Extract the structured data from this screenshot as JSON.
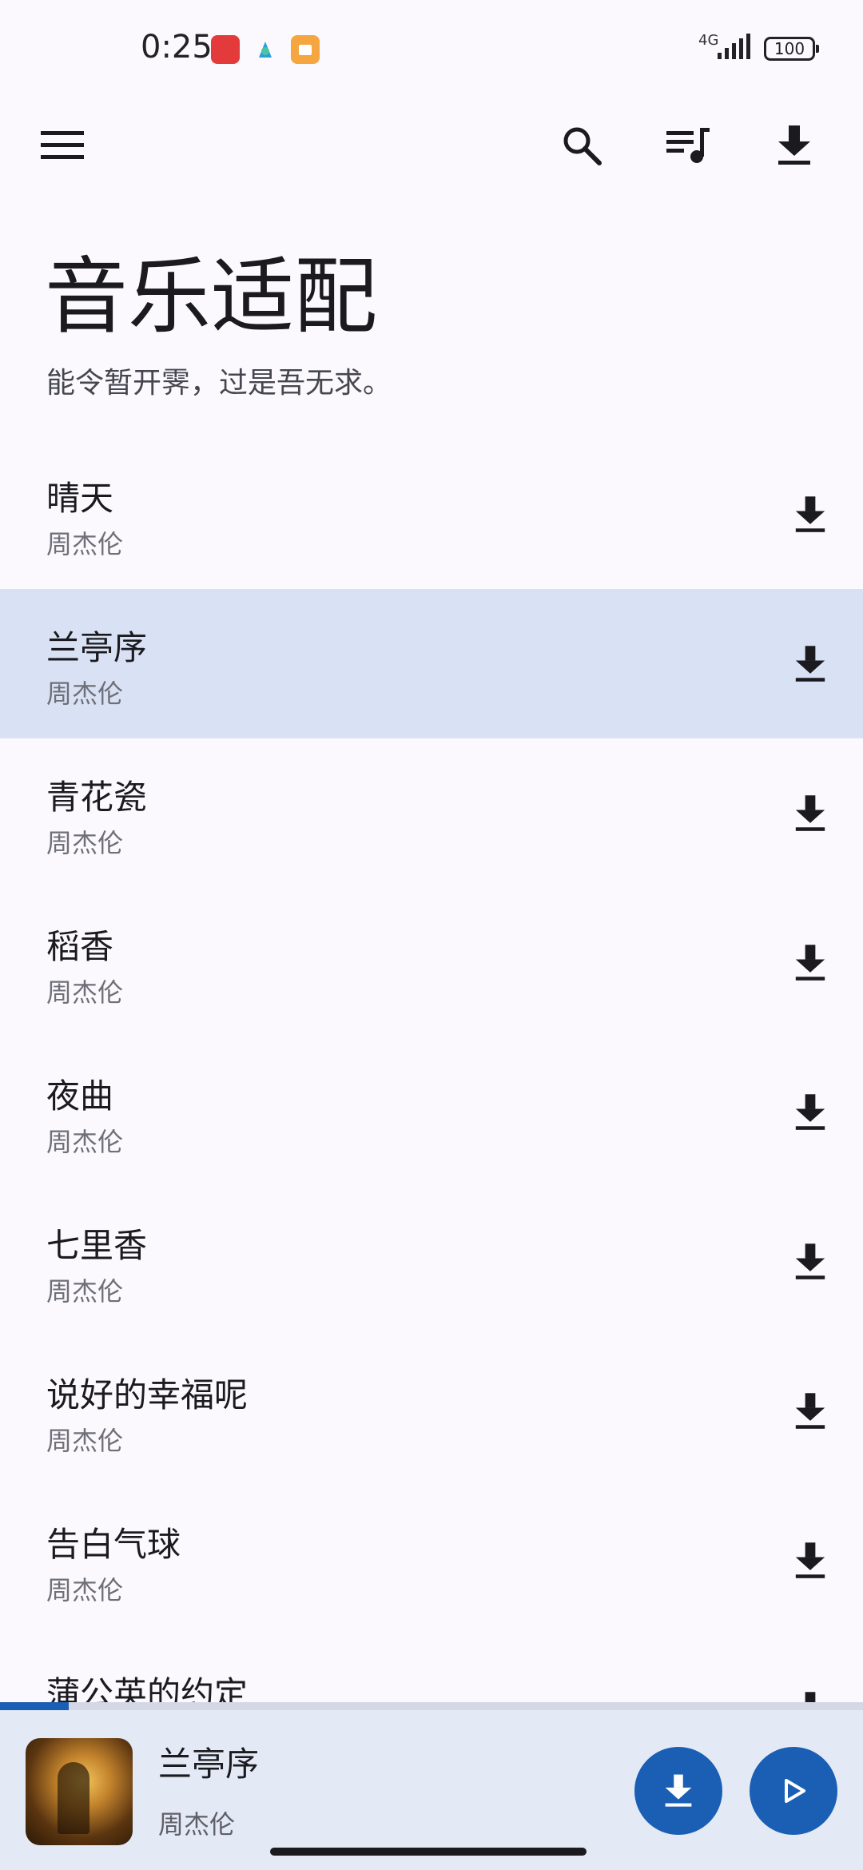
{
  "status": {
    "time": "0:25",
    "network": "4G",
    "battery": "100"
  },
  "header": {
    "title": "音乐适配",
    "subtitle": "能令暂开霁，过是吾无求。"
  },
  "songs": [
    {
      "title": "晴天",
      "artist": "周杰伦"
    },
    {
      "title": "兰亭序",
      "artist": "周杰伦"
    },
    {
      "title": "青花瓷",
      "artist": "周杰伦"
    },
    {
      "title": "稻香",
      "artist": "周杰伦"
    },
    {
      "title": "夜曲",
      "artist": "周杰伦"
    },
    {
      "title": "七里香",
      "artist": "周杰伦"
    },
    {
      "title": "说好的幸福呢",
      "artist": "周杰伦"
    },
    {
      "title": "告白气球",
      "artist": "周杰伦"
    },
    {
      "title": "蒲公英的约定",
      "artist": ""
    }
  ],
  "selected_index": 1,
  "player": {
    "title": "兰亭序",
    "artist": "周杰伦",
    "progress_fraction": 0.08
  },
  "colors": {
    "accent": "#1a5fb4",
    "selected_row": "#d9e2f4",
    "player_bg": "#e4e9f6",
    "background": "#fbf9fe"
  },
  "icons": {
    "menu": "hamburger-menu-icon",
    "search": "search-icon",
    "queue": "playlist-music-icon",
    "download": "download-icon",
    "play": "play-icon"
  }
}
